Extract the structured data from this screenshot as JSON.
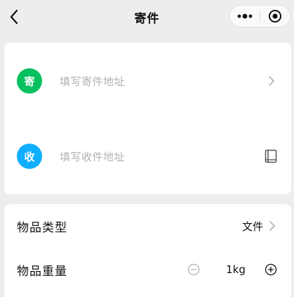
{
  "navbar": {
    "title": "寄件",
    "back_icon": "chevron-left-icon",
    "more_icon": "more-dots-icon",
    "close_icon": "target-circle-icon"
  },
  "address": {
    "sender": {
      "badge": "寄",
      "placeholder": "填写寄件地址",
      "badge_color": "#07c160",
      "icon": "chevron-right-icon"
    },
    "receiver": {
      "badge": "收",
      "placeholder": "填写收件地址",
      "badge_color": "#10aeff",
      "icon": "address-book-icon"
    }
  },
  "item": {
    "type_label": "物品类型",
    "type_value": "文件",
    "weight_label": "物品重量",
    "weight_value": "1kg"
  },
  "colors": {
    "background": "#ededed",
    "card": "#ffffff",
    "placeholder_text": "#b2b2b2"
  }
}
